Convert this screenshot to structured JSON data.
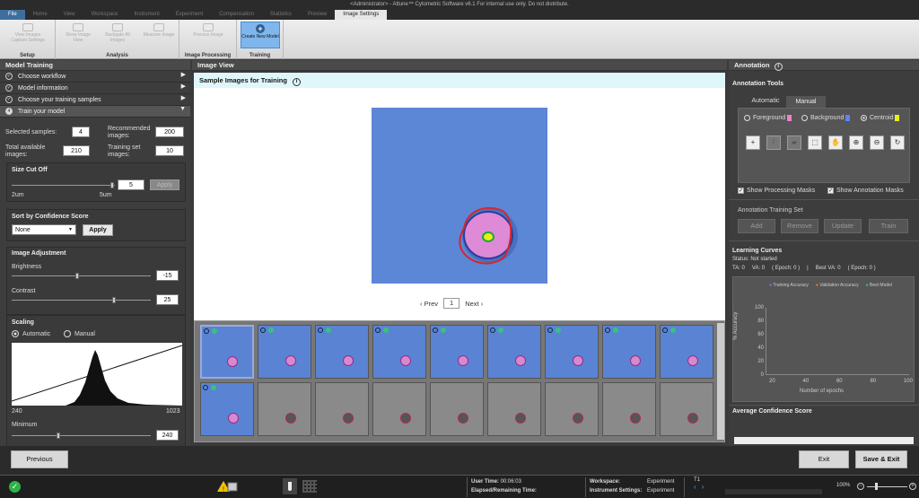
{
  "window": {
    "title": "<Administrator> - Attune™ Cytometric Software v6.1 For internal use only. Do not distribute."
  },
  "tabs": [
    "File",
    "Home",
    "View",
    "Workspace",
    "Instrument",
    "Experiment",
    "Compensation",
    "Statistics",
    "Preview",
    "Image Settings"
  ],
  "ribbon": {
    "groups": [
      "Setup",
      "Analysis",
      "Image Processing",
      "Training"
    ],
    "buttons": [
      "View Images Capture Settings",
      "Show Image View",
      "Backgate All Images",
      "Measure Image",
      "Process Image",
      "Create New Model"
    ]
  },
  "left": {
    "header": "Model Training",
    "workflow": [
      "Choose workflow",
      "Model information",
      "Choose your training samples",
      "Train your model"
    ],
    "workflow_step": "4",
    "selected_samples_label": "Selected samples:",
    "selected_samples": "4",
    "recommended_label": "Recommended images:",
    "recommended": "200",
    "total_label": "Total available images:",
    "total": "210",
    "training_set_label": "Training set images:",
    "training_set": "10",
    "size_cutoff": {
      "title": "Size Cut Off",
      "value": "5",
      "apply": "Apply",
      "min": "2um",
      "max": "5um"
    },
    "sort": {
      "title": "Sort by Confidence Score",
      "value": "None",
      "apply": "Apply"
    },
    "adjust": {
      "title": "Image Adjustment",
      "brightness_label": "Brightness",
      "brightness": "-15",
      "contrast_label": "Contrast",
      "contrast": "25"
    },
    "scaling": {
      "title": "Scaling",
      "auto": "Automatic",
      "manual": "Manual",
      "hist_min": "240",
      "hist_max": "1023",
      "minimum_label": "Minimum",
      "minimum": "240"
    }
  },
  "center": {
    "header": "Image View",
    "sample_header": "Sample Images for Training",
    "prev": "Prev",
    "page": "1",
    "next": "Next"
  },
  "right": {
    "header": "Annotation",
    "tools_title": "Annotation Tools",
    "tab_auto": "Automatic",
    "tab_manual": "Manual",
    "radio_fg": "Foreground",
    "radio_bg": "Background",
    "radio_centroid": "Centroid",
    "show_proc": "Show Processing Masks",
    "show_ann": "Show Annotation Masks",
    "set_title": "Annotation Training Set",
    "add": "Add",
    "remove": "Remove",
    "update": "Update",
    "train": "Train",
    "curves_title": "Learning Curves",
    "status": "Status: Not started",
    "metrics": {
      "ta": "TA: 0",
      "va": "VA: 0",
      "epoch1": "( Epoch: 0 )",
      "best": "Best VA: 0",
      "epoch2": "( Epoch: 0 )"
    },
    "legend": [
      "Training Accuracy",
      "Validation Accuracy",
      "Best Model"
    ],
    "legend_colors": [
      "#7a7aff",
      "#ff7a2a",
      "#2ad07a"
    ],
    "yaxis_label": "% Accuracy",
    "yticks": [
      "100",
      "80",
      "60",
      "40",
      "20",
      "0"
    ],
    "xticks": [
      "20",
      "40",
      "60",
      "80",
      "100"
    ],
    "xaxis_label": "Number of epochs",
    "avg_title": "Average Confidence Score"
  },
  "bottom": {
    "previous": "Previous",
    "exit": "Exit",
    "save_exit": "Save & Exit"
  },
  "status": {
    "user_time_label": "User Time:",
    "user_time": "00:06:03",
    "elapsed_label": "Elapsed/Remaining Time:",
    "workspace_label": "Workspace:",
    "workspace": "Experiment",
    "inst_label": "Instrument Settings:",
    "inst": "Experiment",
    "t1": "T1",
    "zoom": "100%"
  }
}
